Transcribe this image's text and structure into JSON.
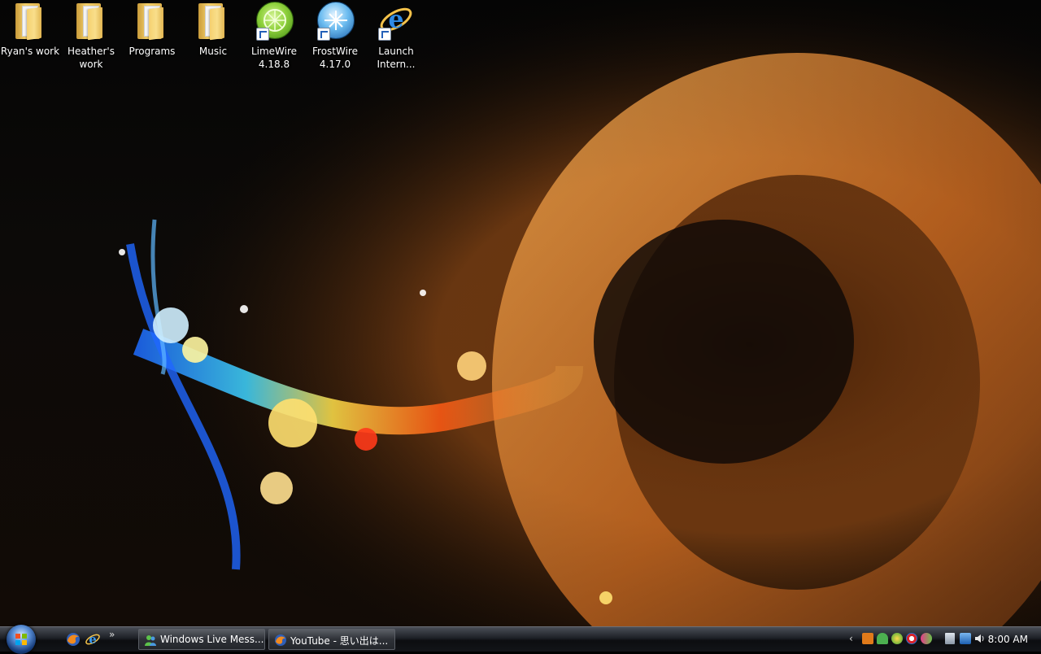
{
  "desktop": {
    "icons": [
      {
        "label": "Ryan's work",
        "icon": "folder-icon"
      },
      {
        "label": "Heather's\nwork",
        "icon": "folder-icon"
      },
      {
        "label": "Programs",
        "icon": "folder-icon"
      },
      {
        "label": "Music",
        "icon": "folder-icon"
      },
      {
        "label": "LimeWire\n4.18.8",
        "icon": "limewire-icon"
      },
      {
        "label": "FrostWire\n4.17.0",
        "icon": "frostwire-icon"
      },
      {
        "label": "Launch\nIntern...",
        "icon": "internet-explorer-icon"
      }
    ]
  },
  "taskbar": {
    "start_icon": "windows-start-orb",
    "quick_launch": [
      "firefox-icon",
      "internet-explorer-icon"
    ],
    "quick_launch_more": "»",
    "tasks": [
      {
        "label": "Windows Live Mess...",
        "icon": "messenger-icon"
      },
      {
        "label": "YouTube - 思い出は...",
        "icon": "firefox-icon"
      }
    ],
    "tray_chevron": "‹",
    "tray_icons": [
      "tray-app-icon",
      "tray-user-icon",
      "tray-sync-icon",
      "tray-msn-icon",
      "tray-network-icon",
      "tray-display-icon",
      "tray-volume-icon"
    ],
    "clock": "8:00 AM"
  }
}
